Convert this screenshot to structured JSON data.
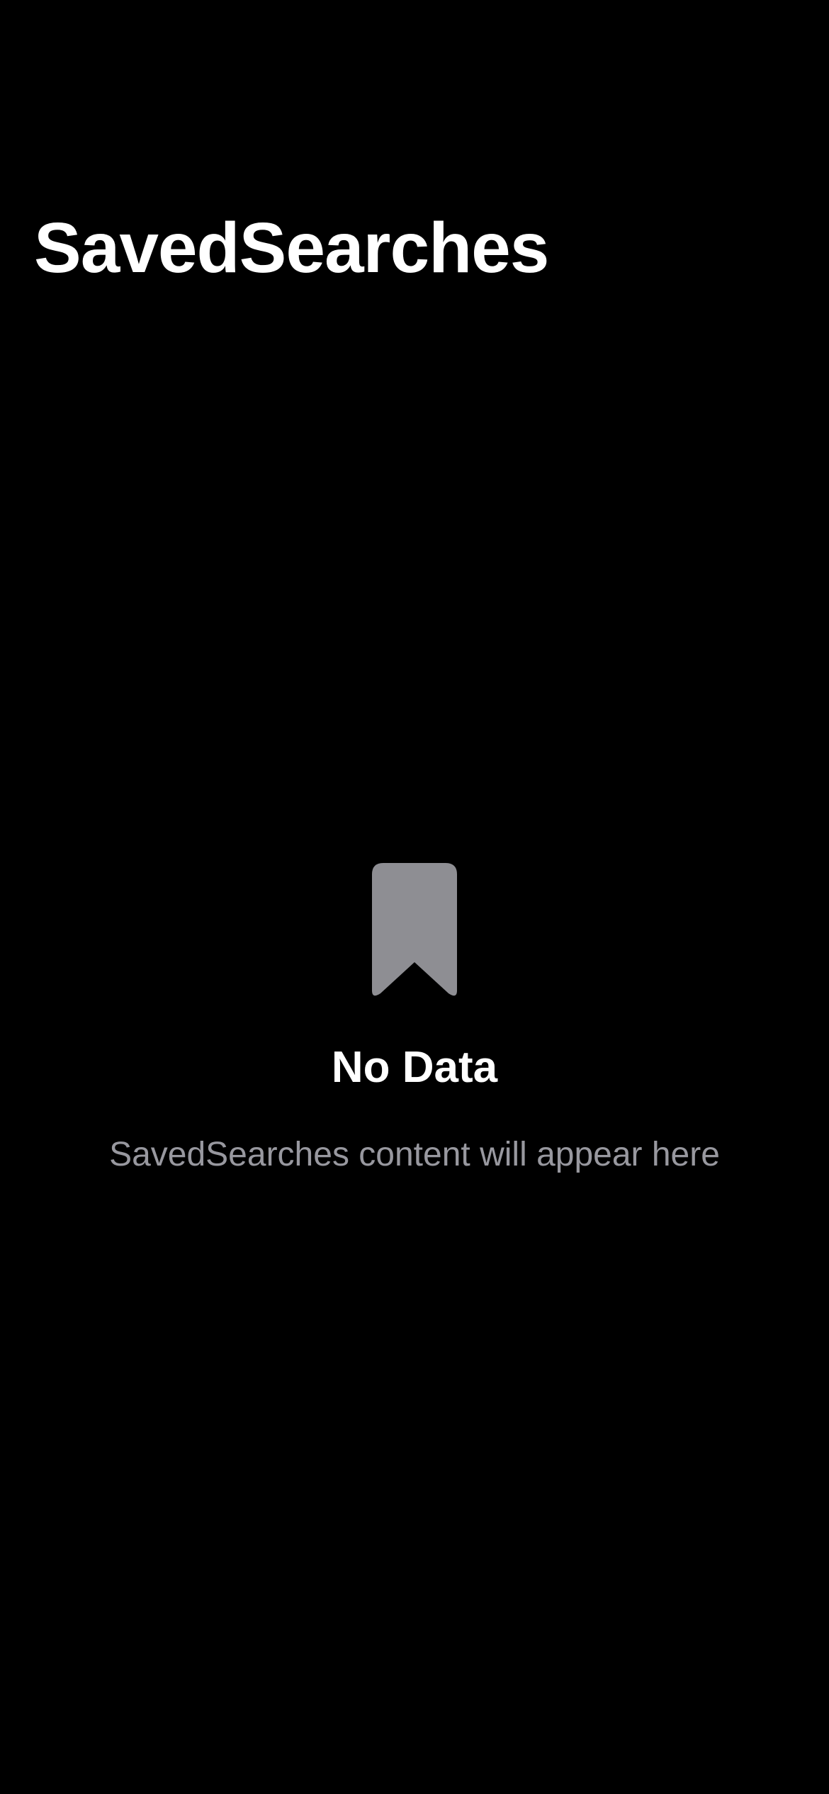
{
  "nav": {
    "title": "SavedSearches"
  },
  "empty_state": {
    "icon": "bookmark-icon",
    "title": "No Data",
    "subtitle": "SavedSearches content will appear here"
  },
  "colors": {
    "background": "#000000",
    "title_text": "#ffffff",
    "secondary_text": "#98989f",
    "icon_fill": "#8e8e93"
  }
}
